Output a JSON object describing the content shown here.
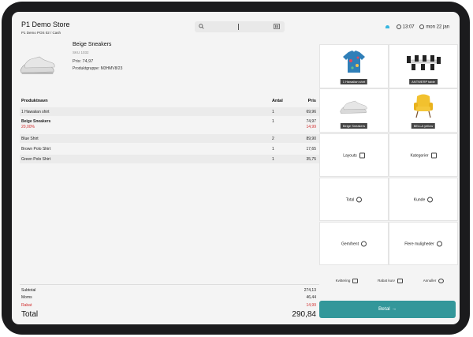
{
  "header": {
    "store_title": "P1 Demo Store",
    "breadcrumb": "P1 Demo POS 02 / Cash",
    "time": "13:07",
    "date": "mon 22 jan"
  },
  "product": {
    "name": "Beige Sneakers",
    "sku": "SKU 1032",
    "price": "Pris: 74,97",
    "group": "Produktgruppe: M3HMV8/23"
  },
  "table": {
    "headers": {
      "name": "Produktnavn",
      "qty": "Antal",
      "price": "Pris"
    },
    "rows": [
      {
        "name": "1 Hawaiian shirt",
        "qty": "1",
        "price": "69,96"
      },
      {
        "name": "Beige Sneakers",
        "sub": "20,00%",
        "qty": "1",
        "price": "74,97",
        "price_sub": "14,99"
      },
      {
        "name": "Blue Shirt",
        "qty": "2",
        "price": "89,90"
      },
      {
        "name": "Brown Polo Shirt",
        "qty": "1",
        "price": "17,65"
      },
      {
        "name": "Green Polo Shirt",
        "qty": "1",
        "price": "35,75"
      }
    ]
  },
  "totals": {
    "subtotal_label": "Subtotal",
    "subtotal": "274,13",
    "moms_label": "Moms",
    "moms": "46,44",
    "rabat_label": "Rabat",
    "rabat": "14,99",
    "total_label": "Total",
    "total": "290,84"
  },
  "tiles": [
    {
      "label": "1 Hawaiian shirt"
    },
    {
      "label": "ANTWERP table"
    },
    {
      "label": "Beige Sneakers"
    },
    {
      "label": "BELLA yellow"
    }
  ],
  "functions": {
    "layouts": "Layouts",
    "categories": "Kategorier",
    "total": "Total",
    "kunde": "Kunde",
    "gem": "Gem/hent",
    "flere": "Flere muligheder"
  },
  "mini": {
    "print": "Kvittering",
    "discount": "Rabat kurv",
    "cancel": "Annuller"
  },
  "pay_label": "Betal →",
  "colors": {
    "accent": "#33979a",
    "discount": "#d12d2d"
  }
}
